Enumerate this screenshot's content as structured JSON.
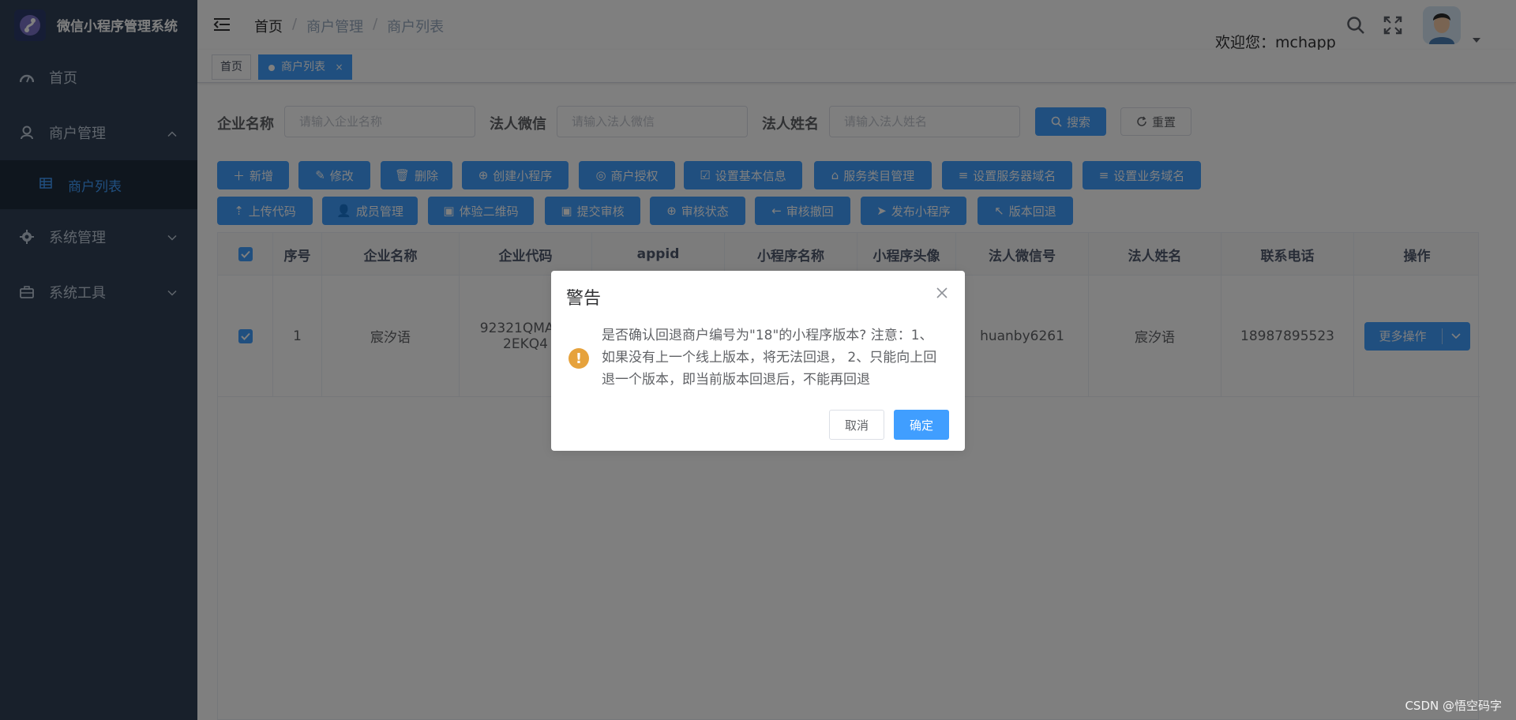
{
  "app": {
    "title": "微信小程序管理系统"
  },
  "sidebar": {
    "items": [
      {
        "label": "首页"
      },
      {
        "label": "商户管理"
      },
      {
        "label": "商户列表"
      },
      {
        "label": "系统管理"
      },
      {
        "label": "系统工具"
      }
    ]
  },
  "header": {
    "breadcrumb": [
      "首页",
      "商户管理",
      "商户列表"
    ],
    "welcome": "欢迎您：mchapp"
  },
  "tags": [
    {
      "label": "首页"
    },
    {
      "label": "商户列表",
      "close": "×"
    }
  ],
  "search": {
    "company_label": "企业名称",
    "company_placeholder": "请输入企业名称",
    "wechat_label": "法人微信",
    "wechat_placeholder": "请输入法人微信",
    "name_label": "法人姓名",
    "name_placeholder": "请输入法人姓名",
    "search_btn": "搜索",
    "reset_btn": "重置"
  },
  "toolbar": {
    "row1": [
      "新增",
      "修改",
      "删除",
      "创建小程序",
      "商户授权",
      "设置基本信息",
      "服务类目管理",
      "设置服务器域名",
      "设置业务域名"
    ],
    "row2": [
      "上传代码",
      "成员管理",
      "体验二维码",
      "提交审核",
      "审核状态",
      "审核撤回",
      "发布小程序",
      "版本回退"
    ]
  },
  "table": {
    "headers": [
      "序号",
      "企业名称",
      "企业代码",
      "appid",
      "小程序名称",
      "小程序头像",
      "法人微信号",
      "法人姓名",
      "联系电话",
      "操作"
    ],
    "rows": [
      {
        "index": "1",
        "company": "宸汐语",
        "code": "92321QMA34 2EKQ4",
        "appid": "",
        "mp_name": "",
        "avatar": "",
        "wechat": "huanby6261",
        "legal_name": "宸汐语",
        "phone": "18987895523",
        "action": "更多操作"
      }
    ]
  },
  "dialog": {
    "title": "警告",
    "message": "是否确认回退商户编号为\"18\"的小程序版本? 注意：1、如果没有上一个线上版本，将无法回退， 2、只能向上回退一个版本，即当前版本回退后，不能再回退",
    "cancel": "取消",
    "confirm": "确定"
  },
  "watermark": "CSDN @悟空码字",
  "colors": {
    "sidebar": "#304156",
    "primary": "#409eff",
    "warning": "#e6a23c"
  }
}
